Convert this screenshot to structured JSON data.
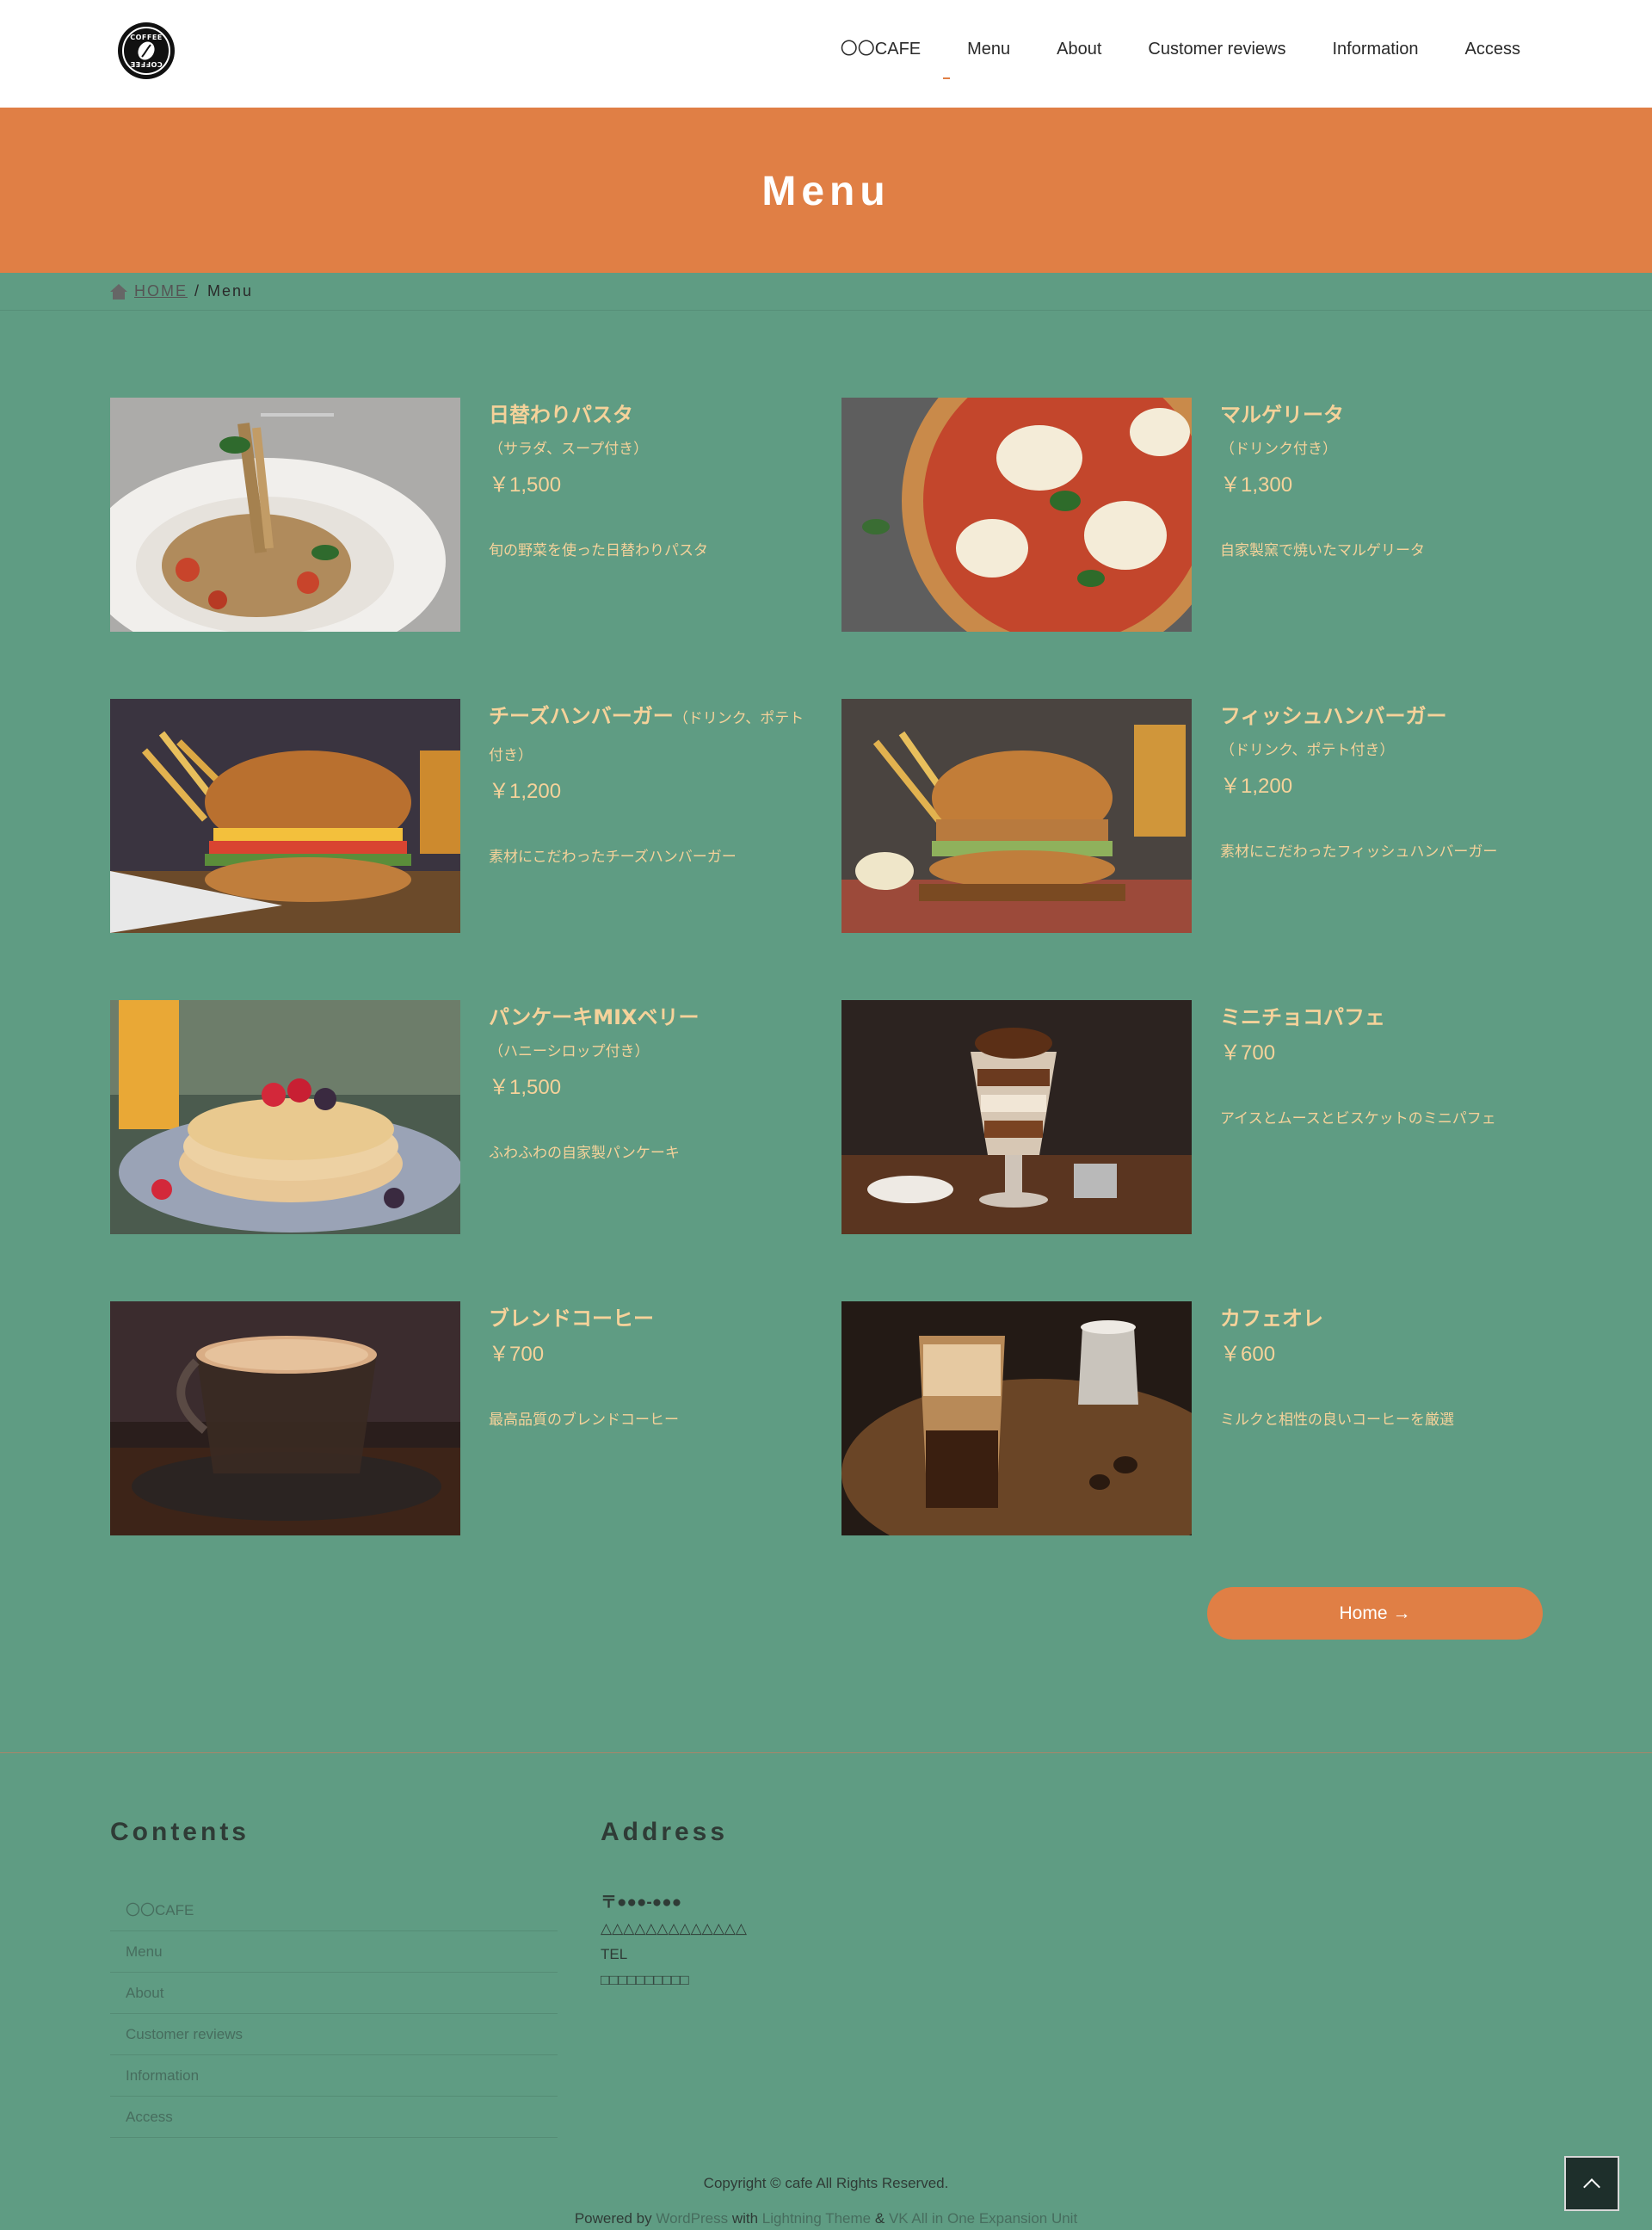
{
  "header": {
    "logo_text_top": "COFFEE",
    "logo_text_bottom": "COFFEE",
    "nav": [
      "〇〇CAFE",
      "Menu",
      "About",
      "Customer reviews",
      "Information",
      "Access"
    ]
  },
  "title_band": {
    "title": "Menu"
  },
  "breadcrumb": {
    "home": "HOME",
    "separator": "/",
    "current": "Menu"
  },
  "menu_items": [
    {
      "name": "日替わりパスタ",
      "note": "（サラダ、スープ付き）",
      "price": "￥1,500",
      "desc": "旬の野菜を使った日替わりパスタ"
    },
    {
      "name": "マルゲリータ",
      "note": "（ドリンク付き）",
      "price": "￥1,300",
      "desc": "自家製窯で焼いたマルゲリータ"
    },
    {
      "name": "チーズハンバーガー",
      "note": "（ドリンク、ポテト付き）",
      "price": "￥1,200",
      "desc": "素材にこだわったチーズハンバーガー"
    },
    {
      "name": "フィッシュハンバーガー",
      "note": "（ドリンク、ポテト付き）",
      "price": "￥1,200",
      "desc": "素材にこだわったフィッシュハンバーガー"
    },
    {
      "name": "パンケーキMIXベリー",
      "note": "（ハニーシロップ付き）",
      "price": "￥1,500",
      "desc": "ふわふわの自家製パンケーキ"
    },
    {
      "name": "ミニチョコパフェ",
      "note": "",
      "price": "￥700",
      "desc": "アイスとムースとビスケットのミニパフェ"
    },
    {
      "name": "ブレンドコーヒー",
      "note": "",
      "price": "￥700",
      "desc": "最高品質のブレンドコーヒー"
    },
    {
      "name": "カフェオレ",
      "note": "",
      "price": "￥600",
      "desc": "ミルクと相性の良いコーヒーを厳選"
    }
  ],
  "home_button": {
    "label": "Home",
    "arrow": "→"
  },
  "footer": {
    "contents_heading": "Contents",
    "contents_links": [
      "〇〇CAFE",
      "Menu",
      "About",
      "Customer reviews",
      "Information",
      "Access"
    ],
    "address_heading": "Address",
    "zip": "〒●●●-●●●",
    "address": "△△△△△△△△△△△△△",
    "tel_label": "TEL",
    "tel": "□□□□□□□□□□",
    "copyright": "Copyright © cafe All Rights Reserved.",
    "powered_prefix": "Powered by",
    "powered_wp": "WordPress",
    "powered_with": "with",
    "powered_theme": "Lightning Theme",
    "powered_amp": "&",
    "powered_vk": "VK All in One Expansion Unit"
  },
  "colors": {
    "page_bg": "#5f9c83",
    "accent_orange": "#e07f45",
    "menu_text": "#f5d29a"
  }
}
